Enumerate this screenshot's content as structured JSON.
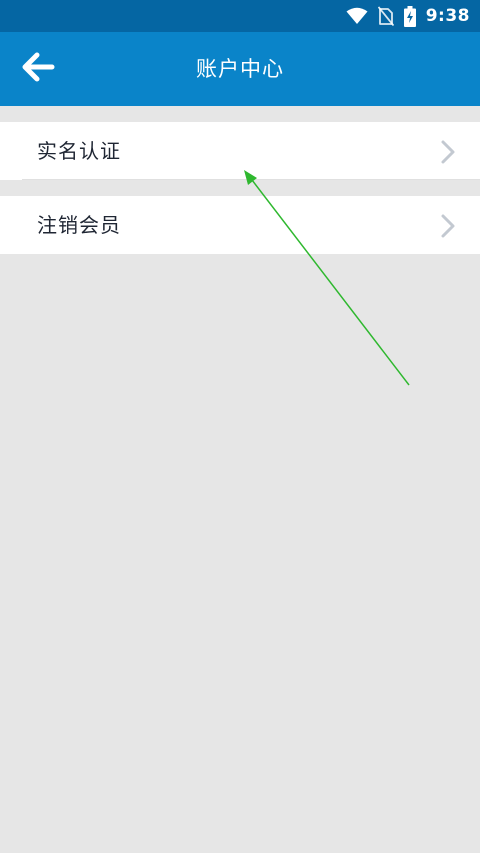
{
  "status_bar": {
    "time": "9:38",
    "icons": [
      "wifi-icon",
      "no-sim-icon",
      "battery-charging-icon"
    ]
  },
  "header": {
    "back_icon": "arrow-left-icon",
    "title": "账户中心",
    "background": "#0a84c9"
  },
  "menu": {
    "items": [
      {
        "label": "实名认证",
        "icon": "chevron-right-icon"
      },
      {
        "label": "注销会员",
        "icon": "chevron-right-icon"
      }
    ]
  },
  "annotation": {
    "type": "arrow",
    "color": "#2fb82f"
  }
}
